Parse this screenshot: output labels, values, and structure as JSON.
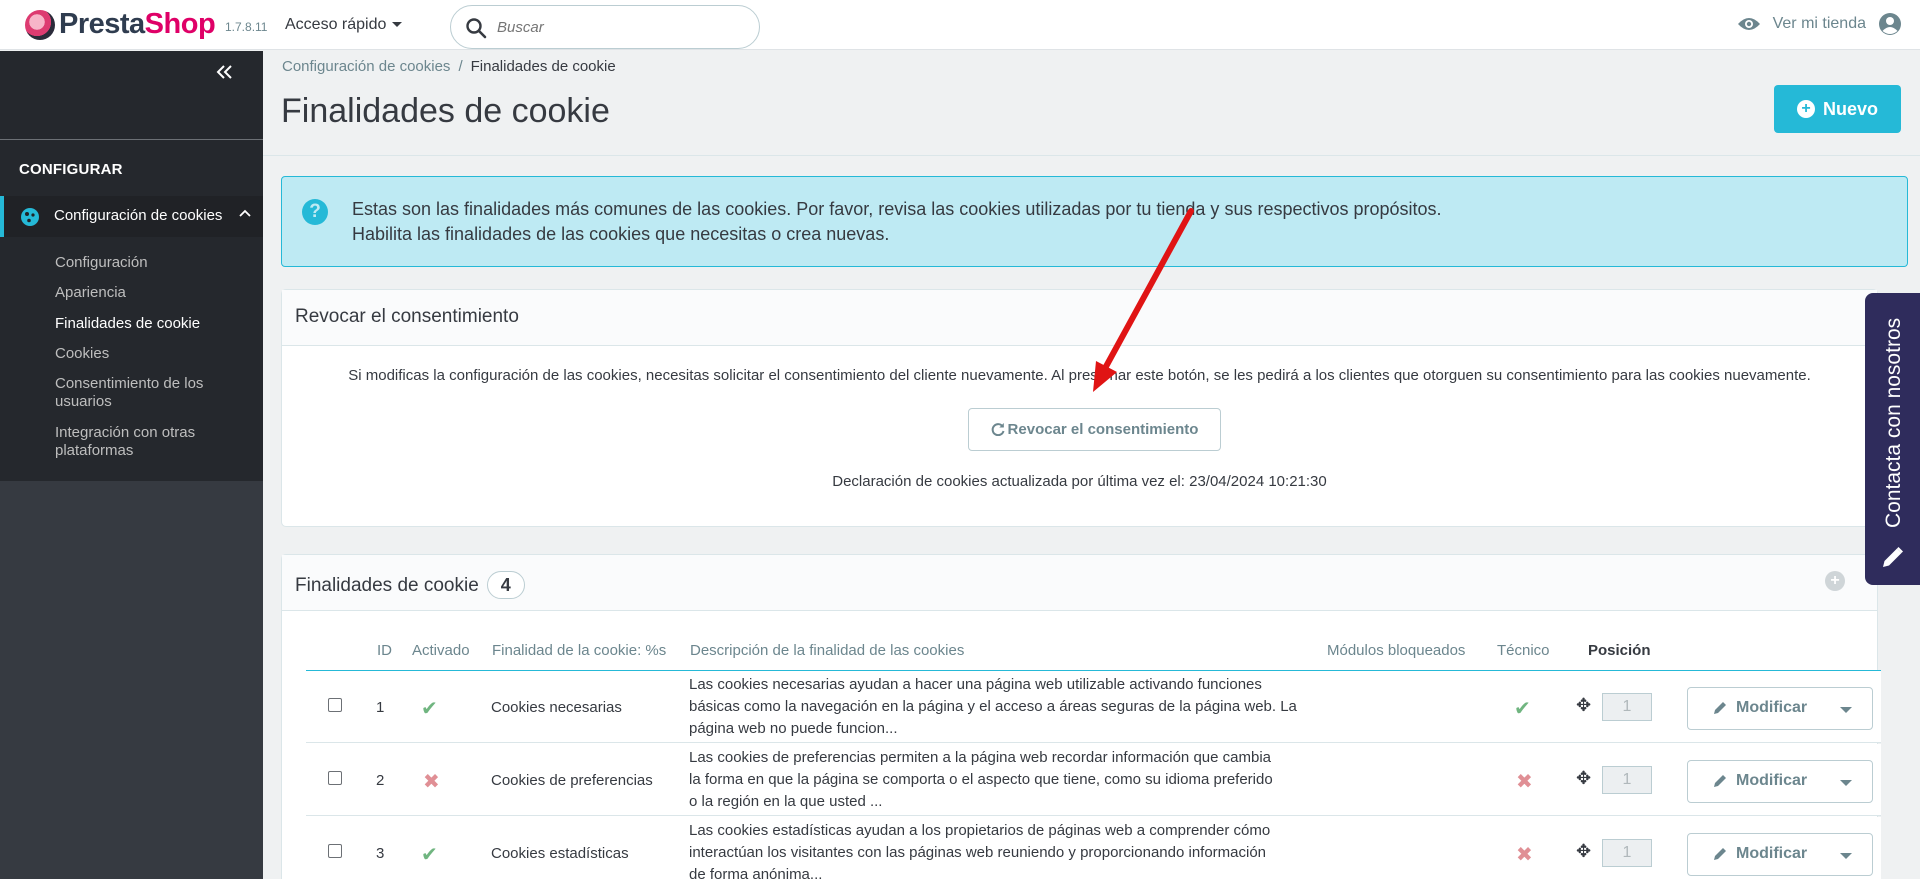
{
  "header": {
    "logo_part1": "Presta",
    "logo_part2": "Shop",
    "version": "1.7.8.11",
    "quick_access": "Acceso rápido",
    "search_placeholder": "Buscar",
    "view_store": "Ver mi tienda"
  },
  "sidebar": {
    "section_title": "CONFIGURAR",
    "active_item": "Configuración de cookies",
    "sub_items": [
      {
        "label": "Configuración"
      },
      {
        "label": "Apariencia"
      },
      {
        "label": "Finalidades de cookie"
      },
      {
        "label": "Cookies"
      },
      {
        "label": "Consentimiento de los usuarios"
      },
      {
        "label": "Integración con otras plataformas"
      }
    ]
  },
  "breadcrumb": {
    "parent": "Configuración de cookies",
    "separator": "/",
    "current": "Finalidades de cookie"
  },
  "page": {
    "title": "Finalidades de cookie",
    "new_button": "Nuevo"
  },
  "alert": {
    "line1": "Estas son las finalidades más comunes de las cookies. Por favor, revisa las cookies utilizadas por tu tienda y sus respectivos propósitos.",
    "line2": "Habilita las finalidades de las cookies que necesitas o crea nuevas."
  },
  "revoke_panel": {
    "title": "Revocar el consentimiento",
    "text": "Si modificas la configuración de las cookies, necesitas solicitar el consentimiento del cliente nuevamente. Al presionar este botón, se les pedirá a los clientes que otorguen su consentimiento para las cookies nuevamente.",
    "button": "Revocar el consentimiento",
    "updated": "Declaración de cookies actualizada por última vez el: 23/04/2024 10:21:30"
  },
  "table_panel": {
    "title": "Finalidades de cookie",
    "count": "4",
    "columns": {
      "id": "ID",
      "active": "Activado",
      "purpose": "Finalidad de la cookie: %s",
      "description": "Descripción de la finalidad de las cookies",
      "blocked": "Módulos bloqueados",
      "technical": "Técnico",
      "position": "Posición"
    },
    "rows": [
      {
        "id": "1",
        "active": "yes",
        "purpose": "Cookies necesarias",
        "desc1": "Las cookies necesarias ayudan a hacer una página web utilizable activando funciones",
        "desc2": "básicas como la navegación en la página y el acceso a áreas seguras de la página web. La",
        "desc3": "página web no puede funcion...",
        "blocked": "",
        "technical": "yes",
        "position": "1",
        "action": "Modificar"
      },
      {
        "id": "2",
        "active": "no",
        "purpose": "Cookies de preferencias",
        "desc1": "Las cookies de preferencias permiten a la página web recordar información que cambia",
        "desc2": "la forma en que la página se comporta o el aspecto que tiene, como su idioma preferido",
        "desc3": "o la región en la que usted ...",
        "blocked": "",
        "technical": "no",
        "position": "1",
        "action": "Modificar"
      },
      {
        "id": "3",
        "active": "yes",
        "purpose": "Cookies estadísticas",
        "desc1": "Las cookies estadísticas ayudan a los propietarios de páginas web a comprender cómo",
        "desc2": "interactúan los visitantes con las páginas web reuniendo y proporcionando información",
        "desc3": "de forma anónima...",
        "blocked": "",
        "technical": "no",
        "position": "1",
        "action": "Modificar"
      }
    ]
  },
  "contact_tab": {
    "label": "Contacta con nosotros"
  },
  "colors": {
    "accent": "#25b9d7",
    "sidebar_bg": "#363a41",
    "success": "#70b580",
    "danger": "#e08f95",
    "annotation_arrow": "#e01414"
  }
}
